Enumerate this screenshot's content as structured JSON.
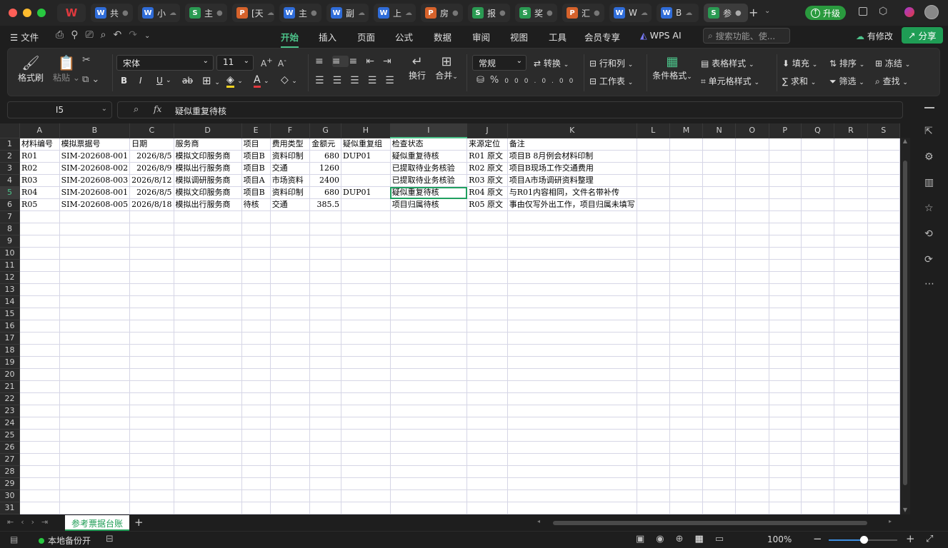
{
  "colors": {
    "accent": "#4cc38a",
    "selection": "#20a060",
    "upgrade_bg": "#2a9a3e",
    "share_bg": "#1f9d55"
  },
  "doc_tabs": [
    {
      "kind": "s",
      "letter": "S",
      "label": "参",
      "active": true
    },
    {
      "kind": "w",
      "letter": "W",
      "label": "共",
      "status": "●"
    },
    {
      "kind": "w",
      "letter": "W",
      "label": "小",
      "status": "☁"
    },
    {
      "kind": "s",
      "letter": "S",
      "label": "主",
      "status": "●"
    },
    {
      "kind": "p",
      "letter": "P",
      "label": "[天",
      "status": "☁"
    },
    {
      "kind": "w",
      "letter": "W",
      "label": "主",
      "status": "●"
    },
    {
      "kind": "w",
      "letter": "W",
      "label": "副",
      "status": "☁"
    },
    {
      "kind": "w",
      "letter": "W",
      "label": "上",
      "status": "☁"
    },
    {
      "kind": "p",
      "letter": "P",
      "label": "房",
      "status": "●"
    },
    {
      "kind": "s",
      "letter": "S",
      "label": "报",
      "status": "●"
    },
    {
      "kind": "s",
      "letter": "S",
      "label": "奖",
      "status": "●"
    },
    {
      "kind": "p",
      "letter": "P",
      "label": "汇",
      "status": "●"
    },
    {
      "kind": "w",
      "letter": "W",
      "label": "W",
      "status": "☁"
    },
    {
      "kind": "w",
      "letter": "W",
      "label": "B",
      "status": "☁"
    }
  ],
  "titlebar": {
    "upgrade": "升级",
    "new_tab": "+",
    "close_tab": "●"
  },
  "menu": {
    "file": "文件",
    "tabs": [
      "开始",
      "插入",
      "页面",
      "公式",
      "数据",
      "审阅",
      "视图",
      "工具",
      "会员专享",
      "WPS AI"
    ],
    "search_placeholder": "搜索功能、使...",
    "has_changes": "有修改",
    "share": "分享"
  },
  "ribbon": {
    "format_painter": "格式刷",
    "paste": "粘贴",
    "font_name": "宋体",
    "font_size": "11",
    "bold": "B",
    "italic": "I",
    "underline": "U",
    "strike": "ab",
    "wrap": "换行",
    "merge": "合并",
    "number_format": "常规",
    "convert": "转换",
    "rows_cols": "行和列",
    "worksheet": "工作表",
    "cond_format": "条件格式",
    "table_style": "表格样式",
    "cell_style": "单元格样式",
    "fill": "填充",
    "sort": "排序",
    "freeze": "冻结",
    "sum": "求和",
    "filter": "筛选",
    "find": "查找"
  },
  "formula_bar": {
    "cell_ref": "I5",
    "fx": "fx",
    "content": "疑似重复待核"
  },
  "columns": [
    "A",
    "B",
    "C",
    "D",
    "E",
    "F",
    "G",
    "H",
    "I",
    "J",
    "K",
    "L",
    "M",
    "N",
    "O",
    "P",
    "Q",
    "R",
    "S"
  ],
  "rows": [
    [
      "材料编号",
      "模拟票据号",
      "日期",
      "服务商",
      "项目",
      "费用类型",
      "金额元",
      "疑似重复组",
      "检查状态",
      "来源定位",
      "备注"
    ],
    [
      "R01",
      "SIM-202608-001",
      "2026/8/5",
      "模拟文印服务商",
      "项目B",
      "资料印制",
      "680",
      "DUP01",
      "疑似重复待核",
      "R01 原文",
      "项目B 8月例会材料印制"
    ],
    [
      "R02",
      "SIM-202608-002",
      "2026/8/9",
      "模拟出行服务商",
      "项目B",
      "交通",
      "1260",
      "",
      "已提取待业务核验",
      "R02 原文",
      "项目B现场工作交通费用"
    ],
    [
      "R03",
      "SIM-202608-003",
      "2026/8/12",
      "模拟调研服务商",
      "项目A",
      "市场资料",
      "2400",
      "",
      "已提取待业务核验",
      "R03 原文",
      "项目A市场调研资料整理"
    ],
    [
      "R04",
      "SIM-202608-001",
      "2026/8/5",
      "模拟文印服务商",
      "项目B",
      "资料印制",
      "680",
      "DUP01",
      "疑似重复待核",
      "R04 原文",
      "与R01内容相同，文件名带补传"
    ],
    [
      "R05",
      "SIM-202608-005",
      "2026/8/18",
      "模拟出行服务商",
      "待核",
      "交通",
      "385.5",
      "",
      "项目归属待核",
      "R05 原文",
      "事由仅写外出工作，项目归属未填写"
    ]
  ],
  "row_count": 31,
  "sheet_tab": "参考票据台账",
  "status": {
    "backup": "本地备份开",
    "zoom": "100%"
  }
}
